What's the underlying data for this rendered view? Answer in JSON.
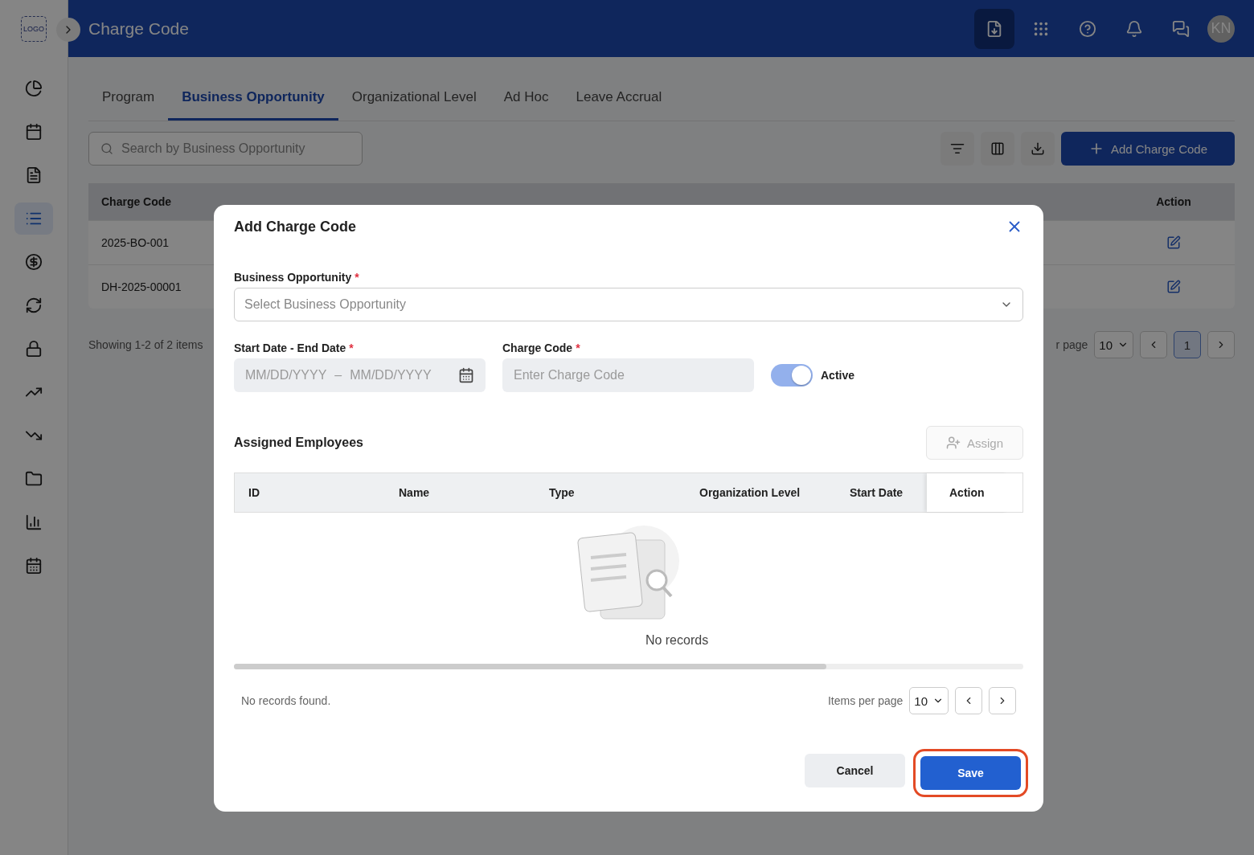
{
  "header": {
    "logo": "LOGO",
    "title": "Charge Code",
    "avatar": "KN"
  },
  "sidebar": {
    "items": [
      {
        "selected": false
      },
      {
        "selected": false
      },
      {
        "selected": false
      },
      {
        "selected": true
      },
      {
        "selected": false
      },
      {
        "selected": false
      },
      {
        "selected": false
      },
      {
        "selected": false
      },
      {
        "selected": false
      },
      {
        "selected": false
      },
      {
        "selected": false
      },
      {
        "selected": false
      }
    ]
  },
  "tabs": [
    {
      "label": "Program",
      "selected": false
    },
    {
      "label": "Business Opportunity",
      "selected": true
    },
    {
      "label": "Organizational Level",
      "selected": false
    },
    {
      "label": "Ad Hoc",
      "selected": false
    },
    {
      "label": "Leave Accrual",
      "selected": false
    }
  ],
  "search": {
    "placeholder": "Search by Business Opportunity"
  },
  "add_button": "Add Charge Code",
  "table": {
    "columns": [
      "Charge Code",
      "Action"
    ],
    "rows": [
      {
        "charge_code": "2025-BO-001"
      },
      {
        "charge_code": "DH-2025-00001"
      }
    ]
  },
  "footer": {
    "summary": "Showing 1-2 of 2 items",
    "per_page_label": "r page",
    "per_page": "10",
    "page": "1"
  },
  "dialog": {
    "title": "Add Charge Code",
    "business_opportunity": {
      "label": "Business Opportunity",
      "required": "*",
      "placeholder": "Select Business Opportunity"
    },
    "dates": {
      "label": "Start Date - End Date",
      "required": "*",
      "start_placeholder": "MM/DD/YYYY",
      "separator": "–",
      "end_placeholder": "MM/DD/YYYY"
    },
    "charge_code": {
      "label": "Charge Code",
      "required": "*",
      "placeholder": "Enter Charge Code"
    },
    "active": {
      "label": "Active",
      "on": true
    },
    "employees": {
      "title": "Assigned Employees",
      "assign_button": {
        "label": "Assign",
        "disabled": true
      },
      "columns": [
        "ID",
        "Name",
        "Type",
        "Organization Level",
        "Start Date"
      ],
      "sticky_column": "Action",
      "empty": "No records",
      "found": "No records found.",
      "per_page_label": "Items per page",
      "per_page": "10"
    },
    "cancel": "Cancel",
    "save": {
      "label": "Save",
      "highlighted": true
    }
  }
}
